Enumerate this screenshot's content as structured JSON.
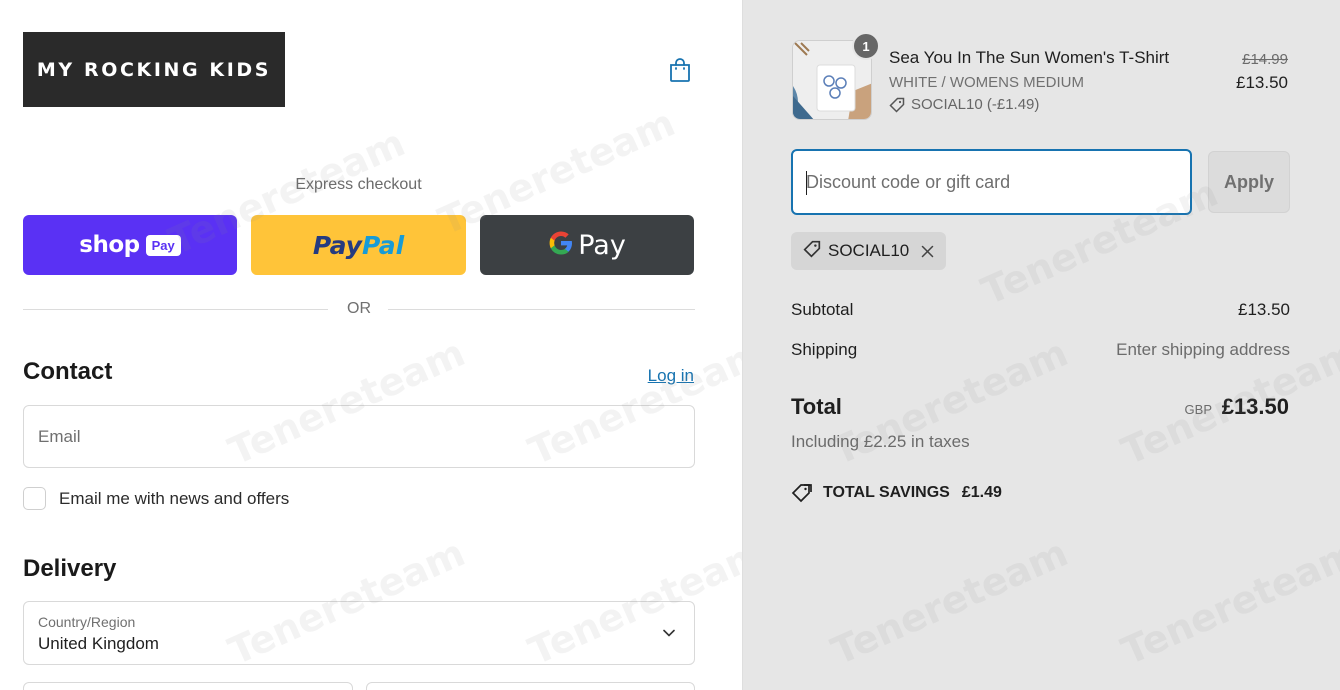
{
  "store": {
    "logo_text": "MY ROCKING KIDS"
  },
  "express": {
    "label": "Express checkout",
    "shop_word": "shop",
    "shop_pill": "Pay",
    "paypal_pay": "Pay",
    "paypal_pal": "Pal",
    "gpay_g": "G",
    "gpay_word": "Pay",
    "or_text": "OR"
  },
  "contact": {
    "title": "Contact",
    "login_link": "Log in",
    "email_placeholder": "Email",
    "newsletter_label": "Email me with news and offers",
    "newsletter_checked": false
  },
  "delivery": {
    "title": "Delivery",
    "country_label": "Country/Region",
    "country_value": "United Kingdom"
  },
  "order": {
    "item": {
      "name": "Sea You In The Sun Women's T-Shirt",
      "variant": "WHITE / WOMENS MEDIUM",
      "discount": "SOCIAL10 (-£1.49)",
      "old_price": "£14.99",
      "price": "£13.50",
      "quantity": "1"
    },
    "discount_placeholder": "Discount code or gift card",
    "apply_label": "Apply",
    "applied_code": "SOCIAL10",
    "subtotal_label": "Subtotal",
    "subtotal_value": "£13.50",
    "shipping_label": "Shipping",
    "shipping_value": "Enter shipping address",
    "total_label": "Total",
    "total_currency": "GBP",
    "total_value": "£13.50",
    "taxes_text": "Including £2.25 in taxes",
    "savings_label": "TOTAL SAVINGS",
    "savings_value": "£1.49"
  },
  "watermark_text": "Tenereteam",
  "colors": {
    "shop_pay": "#5a31f4",
    "paypal": "#ffc439",
    "gpay": "#3c4043",
    "link": "#1773b0",
    "summary_bg": "#e6e6e6"
  }
}
